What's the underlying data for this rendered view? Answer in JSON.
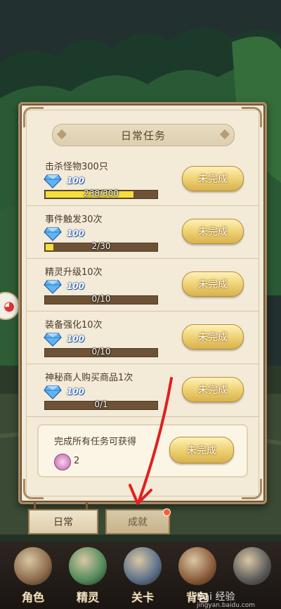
{
  "panel": {
    "title": "日常任务",
    "tasks": [
      {
        "name": "击杀怪物300只",
        "reward": "100",
        "progress_text": "238/300",
        "progress": 0.793,
        "button": "未完成"
      },
      {
        "name": "事件触发30次",
        "reward": "100",
        "progress_text": "2/30",
        "progress": 0.067,
        "button": "未完成"
      },
      {
        "name": "精灵升级10次",
        "reward": "100",
        "progress_text": "0/10",
        "progress": 0.0,
        "button": "未完成"
      },
      {
        "name": "装备强化10次",
        "reward": "100",
        "progress_text": "0/10",
        "progress": 0.0,
        "button": "未完成"
      },
      {
        "name": "神秘商人购买商品1次",
        "reward": "100",
        "progress_text": "0/1",
        "progress": 0.0,
        "button": "未完成"
      }
    ],
    "summary": {
      "text": "完成所有任务可获得",
      "count": "2",
      "button": "未完成"
    }
  },
  "tabs": [
    {
      "label": "日常",
      "active": true
    },
    {
      "label": "成就",
      "active": false,
      "badge": true
    }
  ],
  "nav": [
    {
      "label": "角色",
      "icon": "character-icon",
      "color": "#8a6a4a"
    },
    {
      "label": "精灵",
      "icon": "sprite-icon",
      "color": "#4f8a5a"
    },
    {
      "label": "关卡",
      "icon": "stage-icon",
      "color": "#5a6f8a"
    },
    {
      "label": "背包",
      "icon": "backpack-icon",
      "color": "#8a5a3a"
    },
    {
      "label": "",
      "icon": "extra-icon",
      "color": "#5a5a5a"
    }
  ],
  "watermark": {
    "brand": "Bai 经验",
    "url": "jingyan.baidu.com"
  },
  "colors": {
    "accent": "#f0d67a",
    "progress": "#f4de3a",
    "arrow": "#e02020"
  }
}
